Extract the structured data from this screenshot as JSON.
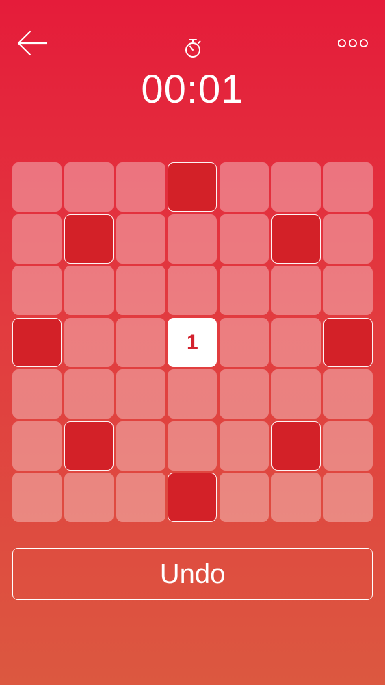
{
  "header": {
    "back_icon": "arrow-left-icon",
    "timer_icon": "stopwatch-icon",
    "more_icon": "ellipsis-icon",
    "timer": "00:01"
  },
  "board": {
    "rows": 7,
    "cols": 7,
    "cells": [
      [
        "",
        "",
        "",
        "filled",
        "",
        "",
        ""
      ],
      [
        "",
        "filled",
        "",
        "",
        "",
        "filled",
        ""
      ],
      [
        "",
        "",
        "",
        "",
        "",
        "",
        ""
      ],
      [
        "filled",
        "",
        "",
        "active",
        "",
        "",
        "filled"
      ],
      [
        "",
        "",
        "",
        "",
        "",
        "",
        ""
      ],
      [
        "",
        "filled",
        "",
        "",
        "",
        "filled",
        ""
      ],
      [
        "",
        "",
        "",
        "filled",
        "",
        "",
        ""
      ]
    ],
    "active_cell": {
      "row": 3,
      "col": 3,
      "value": "1"
    }
  },
  "undo_label": "Undo",
  "colors": {
    "background_top": "#e51c3a",
    "background_bottom": "#dc5840",
    "filled_cell": "#d32128",
    "active_cell": "#ffffff",
    "active_text": "#d3222e"
  }
}
